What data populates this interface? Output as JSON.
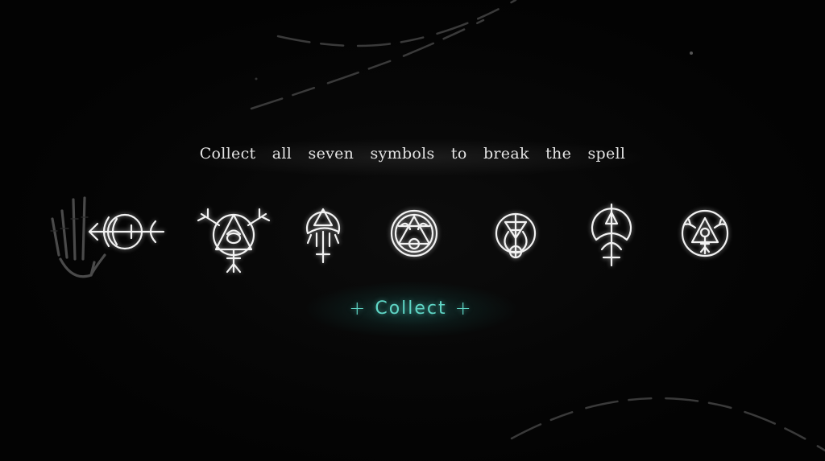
{
  "scene": {
    "instruction": "Collect all seven symbols to break the spell",
    "symbol_count": 7,
    "symbols": [
      {
        "id": "symbol-1",
        "icon": "eye-arrow-sigil-icon"
      },
      {
        "id": "symbol-2",
        "icon": "triangle-eye-antler-sigil-icon"
      },
      {
        "id": "symbol-3",
        "icon": "dome-triangle-cross-sigil-icon"
      },
      {
        "id": "symbol-4",
        "icon": "hexagram-circle-sigil-icon"
      },
      {
        "id": "symbol-5",
        "icon": "chalice-circle-sigil-icon"
      },
      {
        "id": "symbol-6",
        "icon": "arrow-crescent-sigil-icon"
      },
      {
        "id": "symbol-7",
        "icon": "triangle-venus-circle-sigil-icon"
      }
    ],
    "hand_icon": "skeleton-hand-icon"
  },
  "collect_button": {
    "label": "Collect",
    "left_ornament": "+",
    "right_ornament": "+",
    "color": "#5fd6c6"
  }
}
